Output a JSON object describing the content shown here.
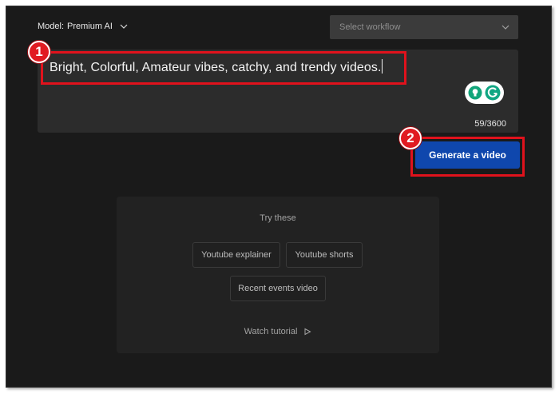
{
  "header": {
    "model_label": "Model:",
    "model_value": "Premium AI",
    "workflow_placeholder": "Select workflow"
  },
  "prompt": {
    "text": "Bright, Colorful, Amateur vibes, catchy, and trendy videos.",
    "counter": "59/3600"
  },
  "actions": {
    "generate_label": "Generate a video"
  },
  "annotations": {
    "badge_1": "1",
    "badge_2": "2",
    "highlight_color": "#e0121c"
  },
  "try_these": {
    "title": "Try these",
    "chips": [
      {
        "label": "Youtube explainer"
      },
      {
        "label": "Youtube shorts"
      },
      {
        "label": "Recent events video"
      }
    ],
    "watch_tutorial": "Watch tutorial"
  },
  "colors": {
    "background": "#1a1a1a",
    "primary_button": "#0f47ad",
    "prompt_box": "#2c2c2c",
    "accent_green": "#12a57a"
  },
  "icons": {
    "model_dropdown": "chevron-down-icon",
    "workflow_dropdown": "chevron-down-icon",
    "tool_1": "lightbulb-icon",
    "tool_2": "grammarly-icon",
    "play": "play-icon"
  }
}
